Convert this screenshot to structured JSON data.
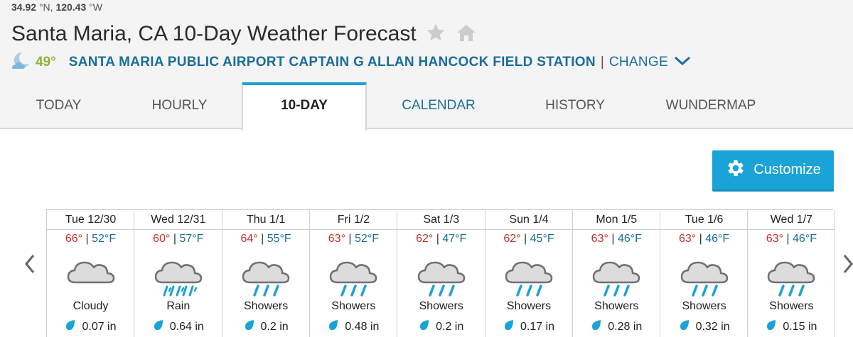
{
  "location": {
    "lat": "34.92",
    "lat_unit": "°N,",
    "lon": "120.43",
    "lon_unit": "°W",
    "title": "Santa Maria, CA 10-Day Weather Forecast"
  },
  "station": {
    "current_temp": "49°",
    "name": "SANTA MARIA PUBLIC AIRPORT CAPTAIN G ALLAN HANCOCK FIELD STATION",
    "separator": "|",
    "change_label": "CHANGE"
  },
  "tabs": [
    {
      "label": "TODAY"
    },
    {
      "label": "HOURLY"
    },
    {
      "label": "10-DAY"
    },
    {
      "label": "CALENDAR"
    },
    {
      "label": "HISTORY"
    },
    {
      "label": "WUNDERMAP"
    }
  ],
  "customize_label": "Customize",
  "colors": {
    "accent": "#1aa3d6",
    "link": "#1a6e9c",
    "high_temp": "#c9302c",
    "current_temp": "#8db33a"
  },
  "days": [
    {
      "date": "Tue 12/30",
      "hi": "66°",
      "lo": "52°F",
      "condition": "Cloudy",
      "icon": "cloud-icon",
      "precip": "0.07 in"
    },
    {
      "date": "Wed 12/31",
      "hi": "60°",
      "lo": "57°F",
      "condition": "Rain",
      "icon": "rain-icon",
      "precip": "0.64 in"
    },
    {
      "date": "Thu 1/1",
      "hi": "64°",
      "lo": "55°F",
      "condition": "Showers",
      "icon": "showers-icon",
      "precip": "0.2 in"
    },
    {
      "date": "Fri 1/2",
      "hi": "63°",
      "lo": "52°F",
      "condition": "Showers",
      "icon": "showers-icon",
      "precip": "0.48 in"
    },
    {
      "date": "Sat 1/3",
      "hi": "62°",
      "lo": "47°F",
      "condition": "Showers",
      "icon": "showers-icon",
      "precip": "0.2 in"
    },
    {
      "date": "Sun 1/4",
      "hi": "62°",
      "lo": "45°F",
      "condition": "Showers",
      "icon": "showers-icon",
      "precip": "0.17 in"
    },
    {
      "date": "Mon 1/5",
      "hi": "63°",
      "lo": "46°F",
      "condition": "Showers",
      "icon": "showers-icon",
      "precip": "0.28 in"
    },
    {
      "date": "Tue 1/6",
      "hi": "63°",
      "lo": "46°F",
      "condition": "Showers",
      "icon": "showers-icon",
      "precip": "0.32 in"
    },
    {
      "date": "Wed 1/7",
      "hi": "63°",
      "lo": "46°F",
      "condition": "Showers",
      "icon": "showers-icon",
      "precip": "0.15 in"
    }
  ]
}
